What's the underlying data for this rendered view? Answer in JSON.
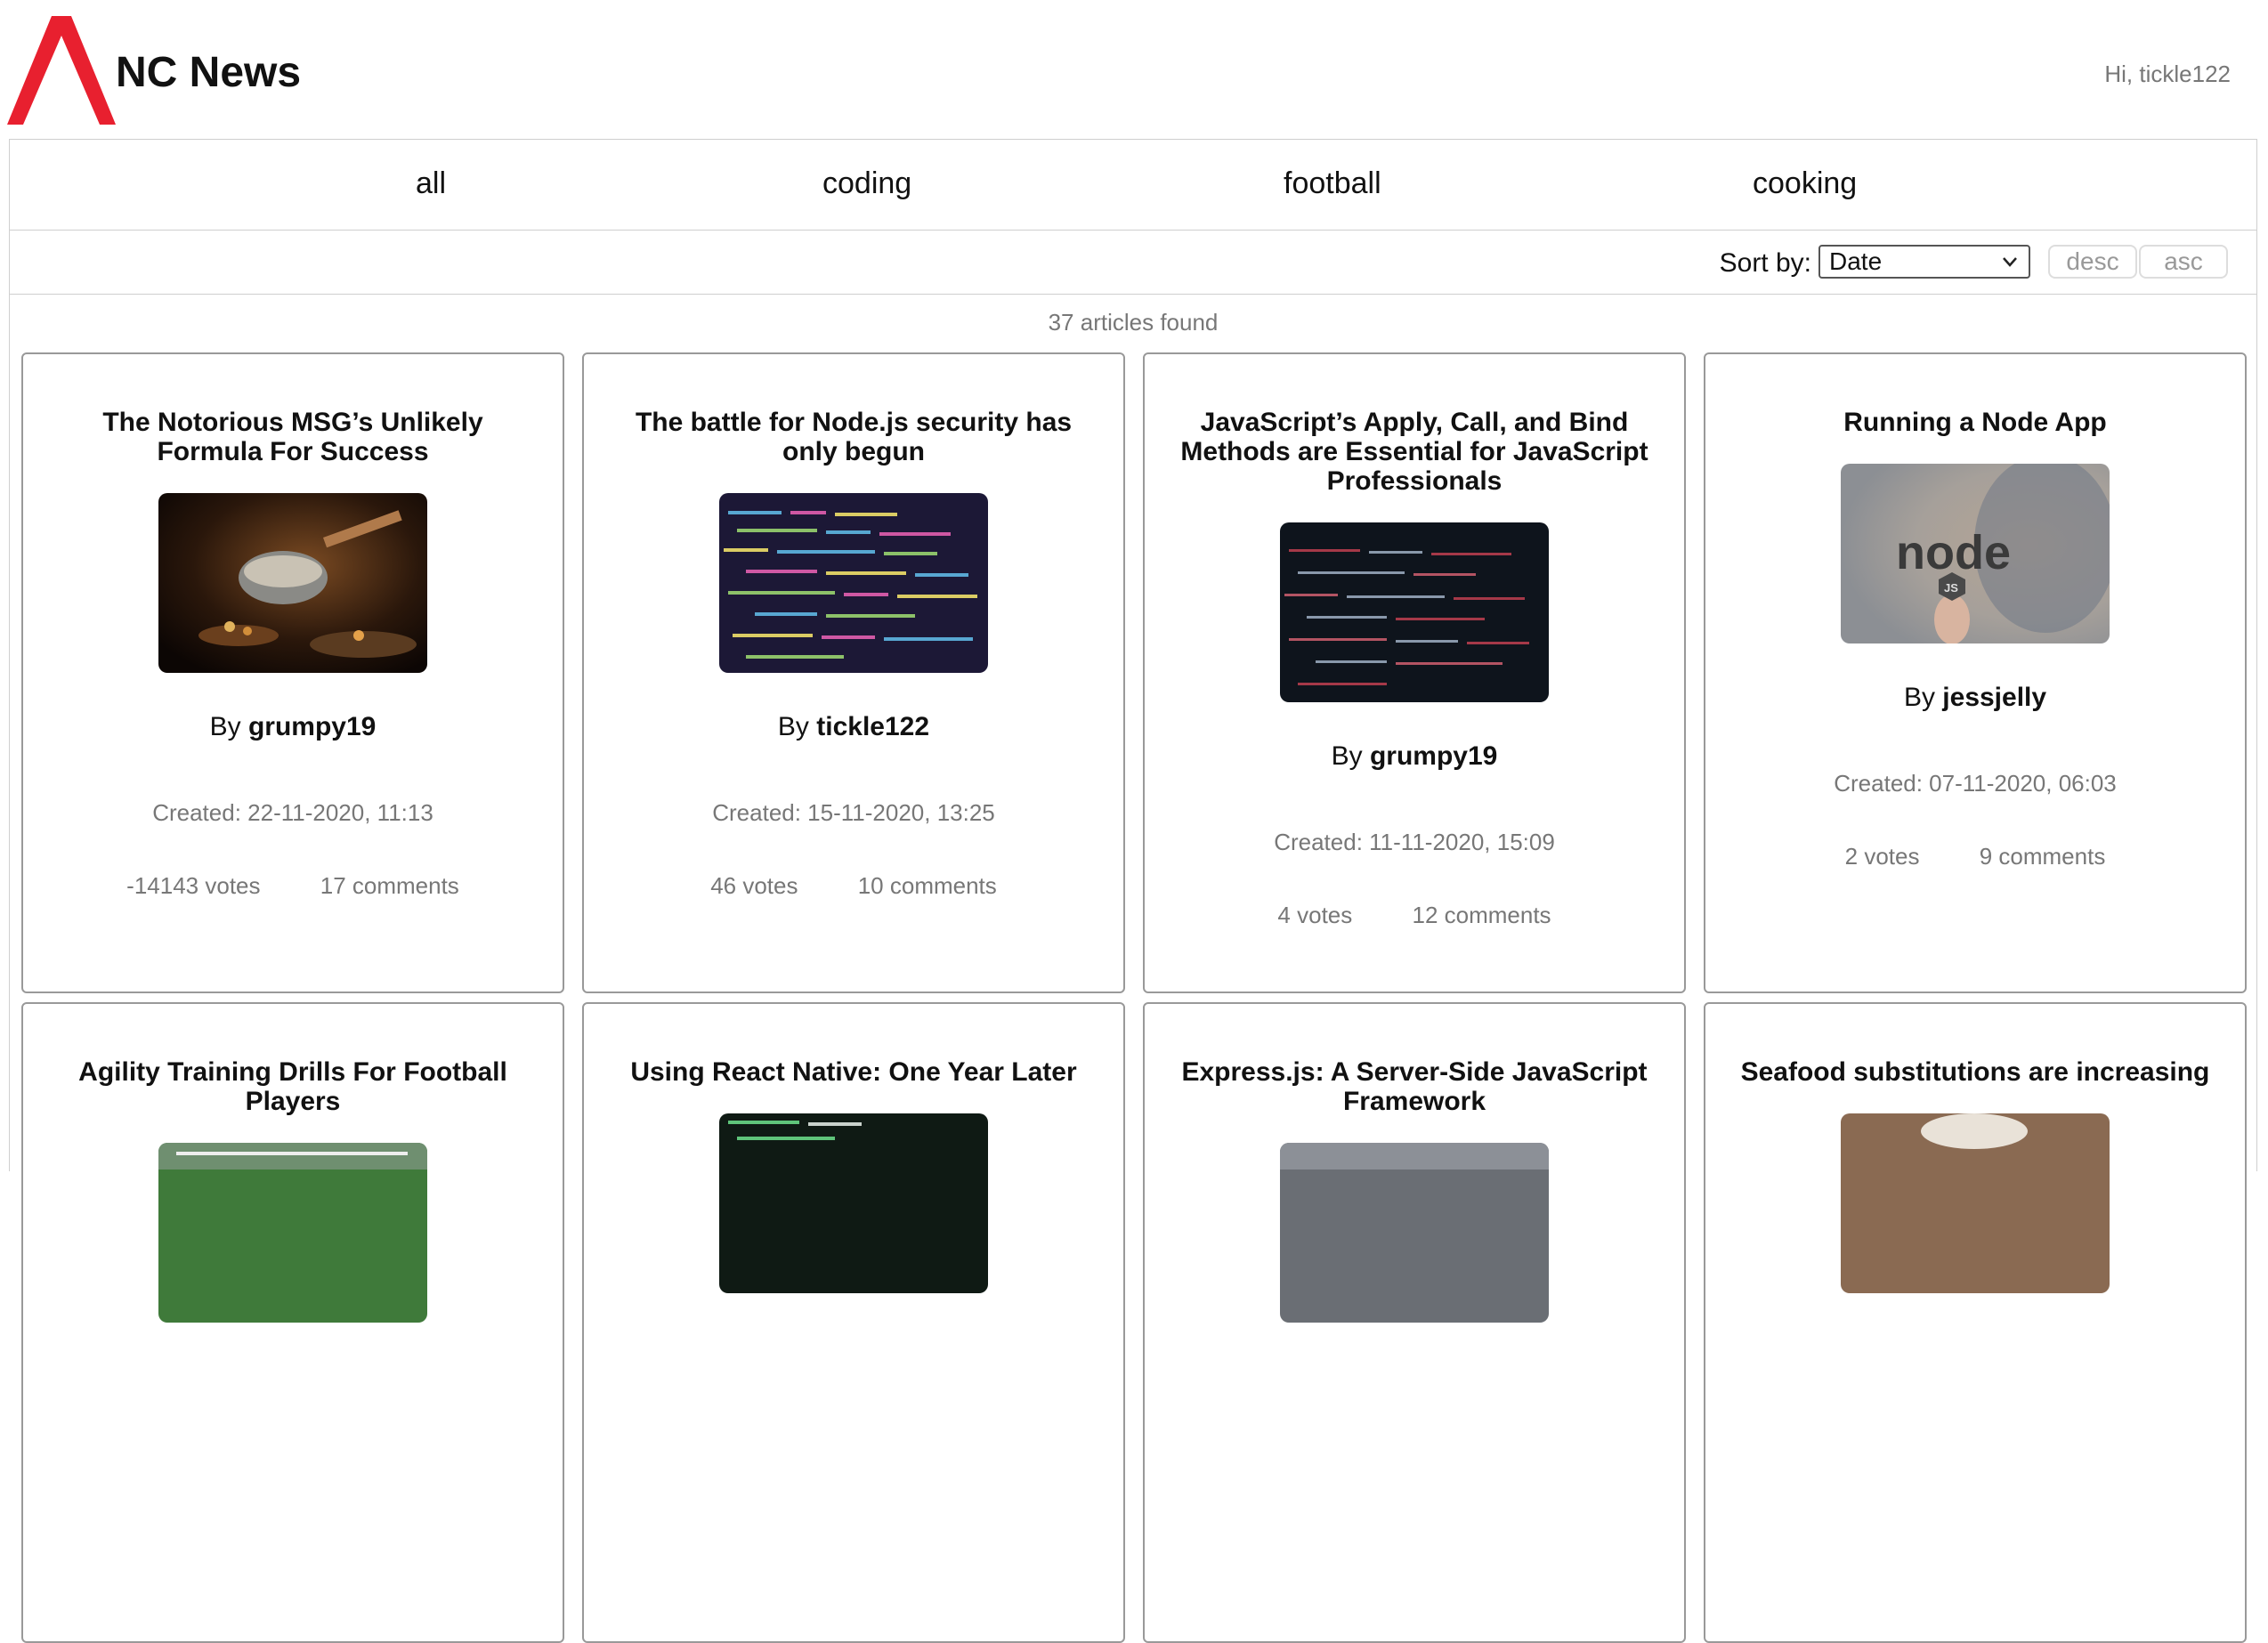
{
  "site": {
    "title": "NC News",
    "greeting": "Hi, tickle122",
    "logo_icon": "red-caret-logo-icon",
    "brand_color": "#e8202f"
  },
  "topics": [
    "all",
    "coding",
    "football",
    "cooking"
  ],
  "sort": {
    "label": "Sort by:",
    "selected": "Date",
    "desc_label": "desc",
    "asc_label": "asc"
  },
  "results": {
    "count_text": "37 articles found"
  },
  "articles": [
    {
      "title": "The Notorious MSG’s Unlikely Formula For Success",
      "author_prefix": "By",
      "author": "grumpy19",
      "created": "Created: 22-11-2020, 11:13",
      "votes": "-14143 votes",
      "comments": "17 comments",
      "image": "cooking-pan-photo"
    },
    {
      "title": "The battle for Node.js security has only begun",
      "author_prefix": "By",
      "author": "tickle122",
      "created": "Created: 15-11-2020, 13:25",
      "votes": "46 votes",
      "comments": "10 comments",
      "image": "colorful-code-photo"
    },
    {
      "title": "JavaScript’s Apply, Call, and Bind Methods are Essential for JavaScript Professionals",
      "author_prefix": "By",
      "author": "grumpy19",
      "created": "Created: 11-11-2020, 15:09",
      "votes": "4 votes",
      "comments": "12 comments",
      "image": "dark-code-screen-photo"
    },
    {
      "title": "Running a Node App",
      "author_prefix": "By",
      "author": "jessjelly",
      "created": "Created: 07-11-2020, 06:03",
      "votes": "2 votes",
      "comments": "9 comments",
      "image": "node-logo-photo"
    },
    {
      "title": "Agility Training Drills For Football Players",
      "image": "football-field-photo"
    },
    {
      "title": "Using React Native: One Year Later",
      "image": "terminal-code-photo"
    },
    {
      "title": "Express.js: A Server-Side JavaScript Framework",
      "image": "laptop-photo"
    },
    {
      "title": "Seafood substitutions are increasing",
      "image": "seafood-plate-photo"
    }
  ]
}
